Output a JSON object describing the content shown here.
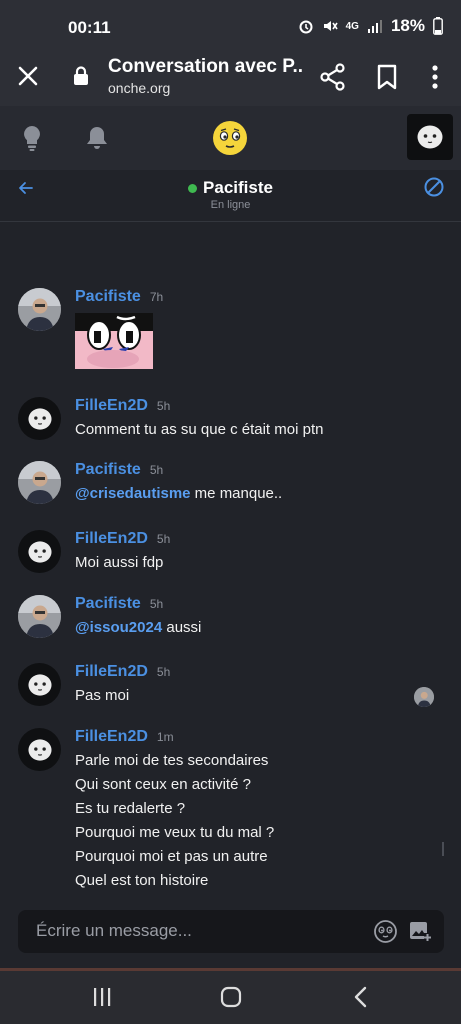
{
  "status_bar": {
    "time": "00:11",
    "network": "4G",
    "battery": "18%"
  },
  "browser": {
    "title": "Conversation avec P...",
    "url": "onche.org"
  },
  "chat": {
    "partner_name": "Pacifiste",
    "partner_status": "En ligne"
  },
  "messages": [
    {
      "author": "Pacifiste",
      "time": "7h",
      "type": "sticker"
    },
    {
      "author": "FilleEn2D",
      "time": "5h",
      "text": "Comment tu as su que c était moi ptn"
    },
    {
      "author": "Pacifiste",
      "time": "5h",
      "mention": "@crisedautisme",
      "text": " me manque.."
    },
    {
      "author": "FilleEn2D",
      "time": "5h",
      "text": "Moi aussi fdp"
    },
    {
      "author": "Pacifiste",
      "time": "5h",
      "mention": "@issou2024",
      "text": " aussi"
    },
    {
      "author": "FilleEn2D",
      "time": "5h",
      "text": "Pas moi"
    },
    {
      "author": "FilleEn2D",
      "time": "1m",
      "lines": [
        "Parle moi de tes secondaires",
        "Qui sont ceux en activité ?",
        "Es tu redalerte ?",
        "Pourquoi me veux tu du mal ?",
        "Pourquoi moi et pas un autre",
        "Quel est ton histoire"
      ]
    }
  ],
  "composer": {
    "placeholder": "Écrire un message..."
  },
  "colors": {
    "accent": "#4b90e2",
    "online": "#3fb950",
    "background": "#212329",
    "logo": "#f5d53b"
  },
  "icons": [
    "close-icon",
    "lock-icon",
    "share-icon",
    "bookmark-icon",
    "more-icon",
    "bulb-icon",
    "bell-icon",
    "onche-logo-icon",
    "back-arrow-icon",
    "block-icon",
    "emoji-icon",
    "image-add-icon"
  ]
}
